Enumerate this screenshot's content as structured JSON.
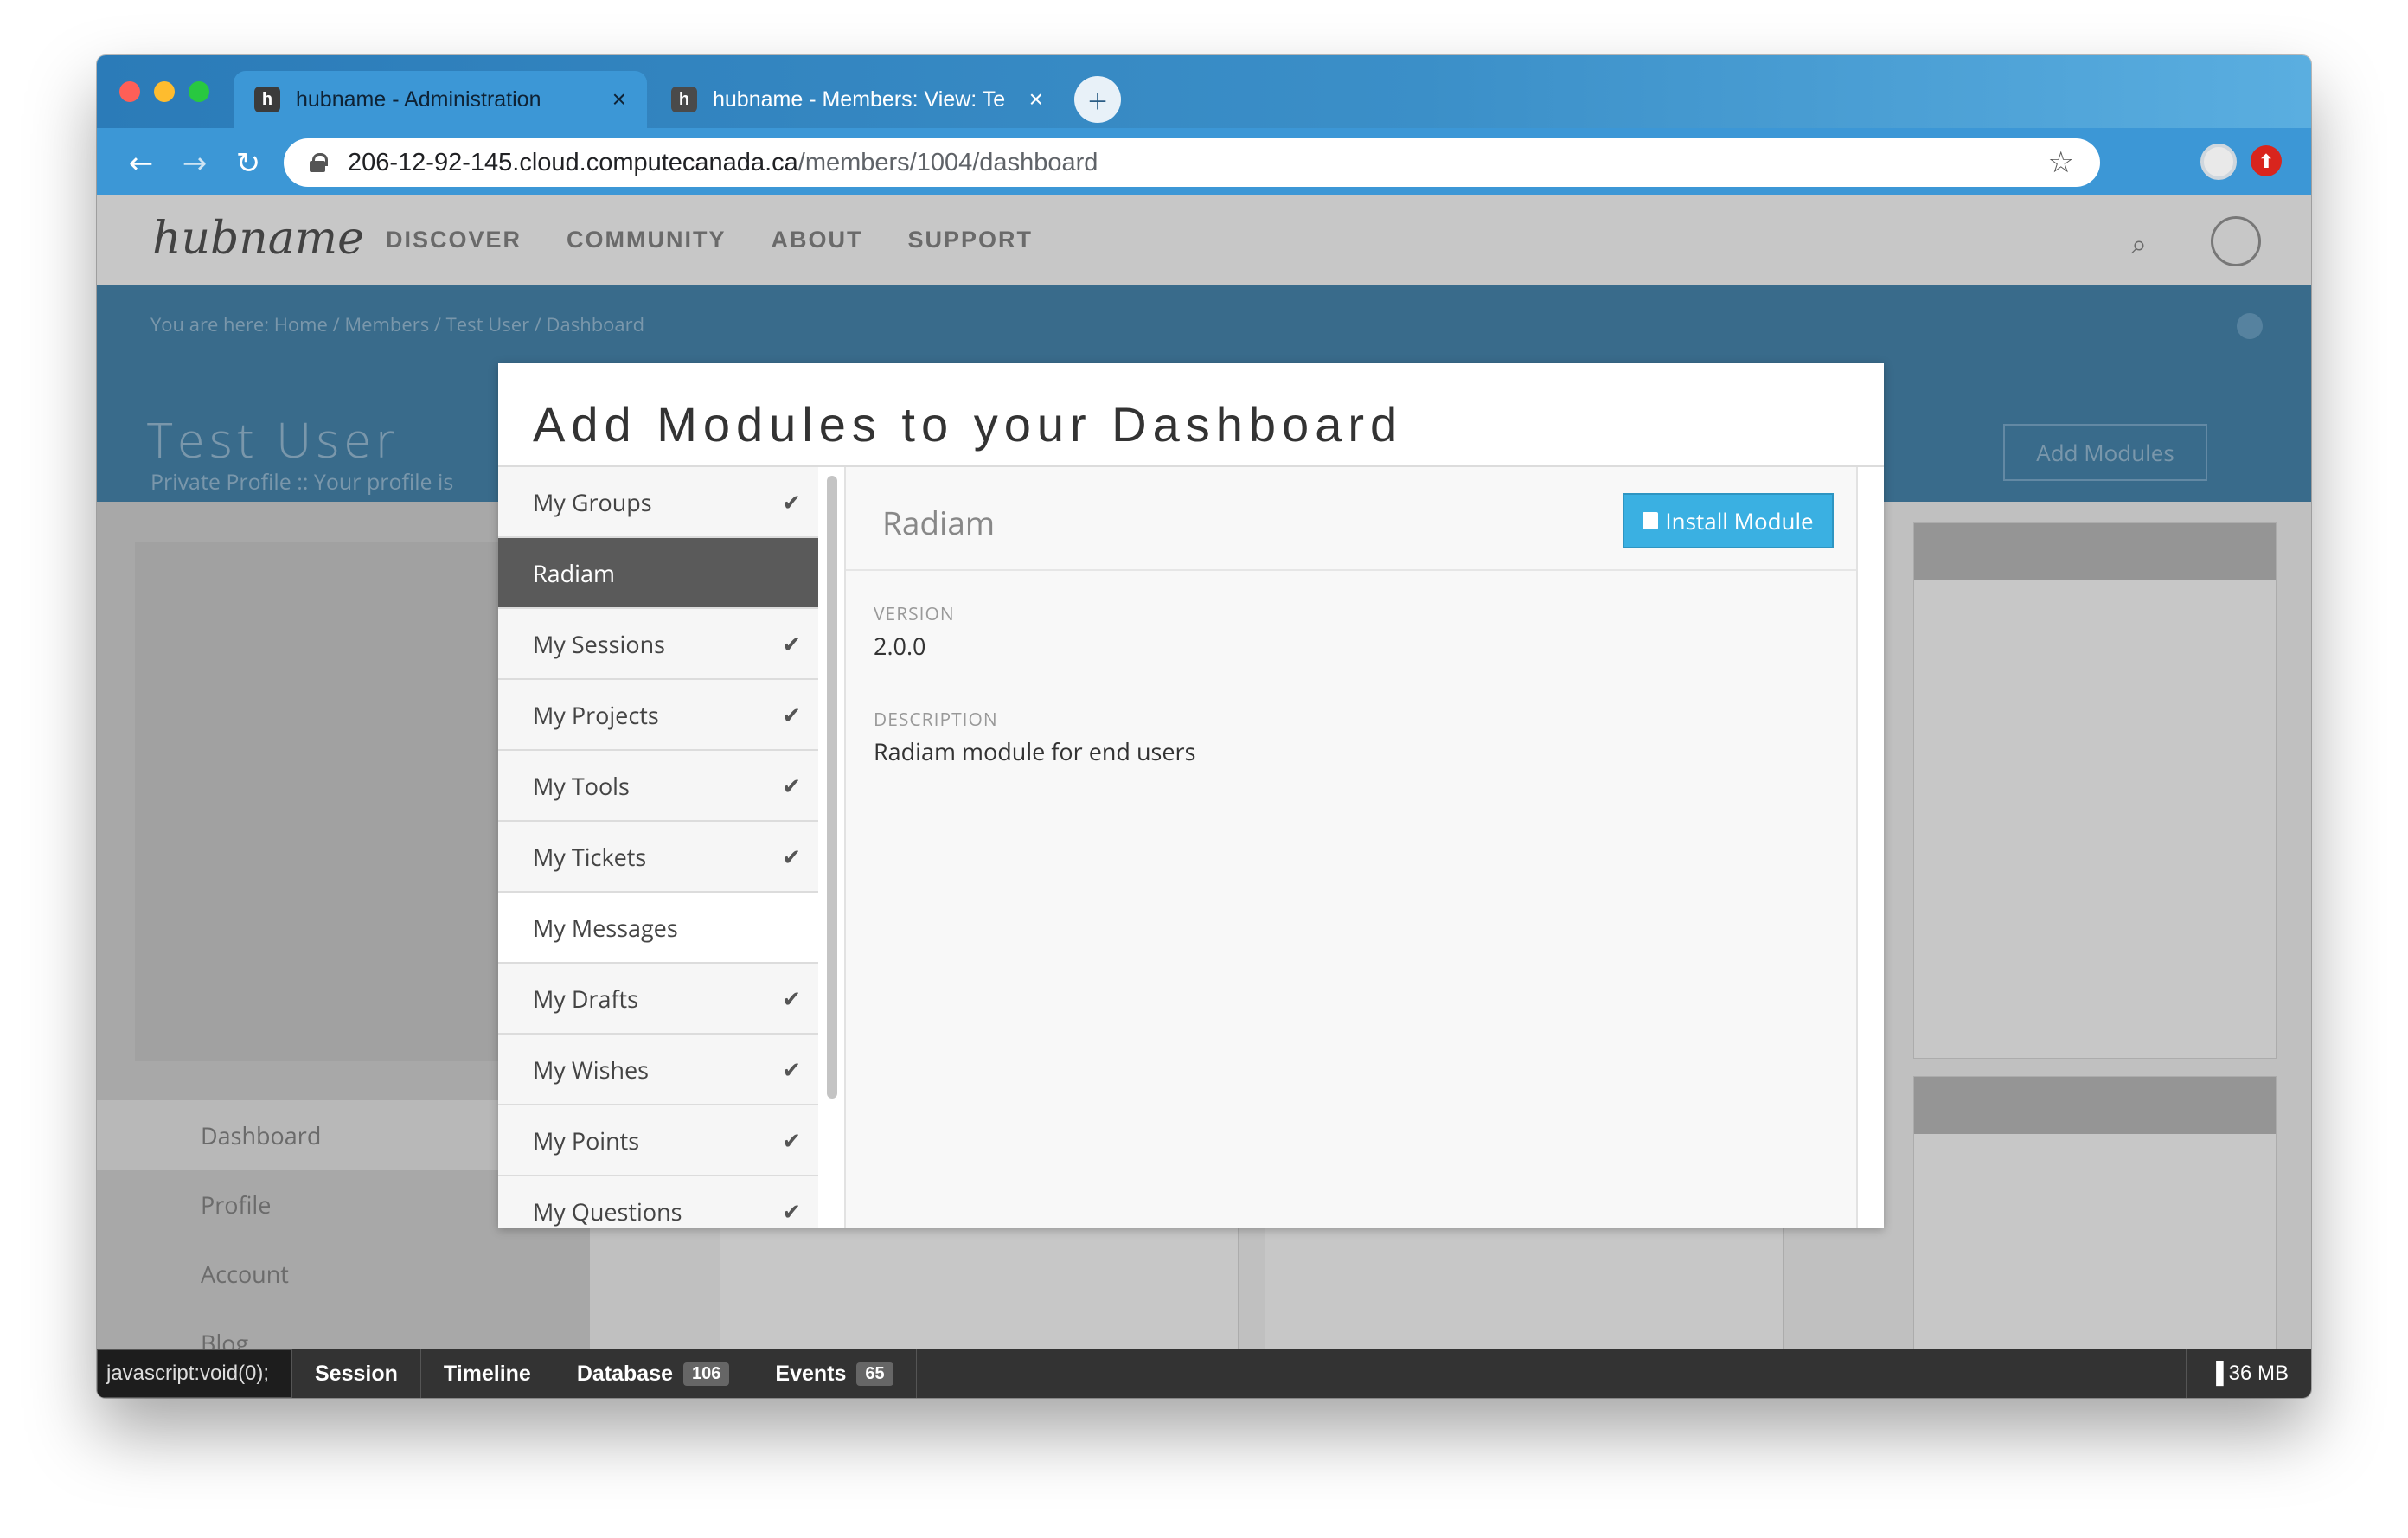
{
  "browser": {
    "tabs": [
      {
        "title": "hubname - Administration",
        "favicon": "h",
        "active": true
      },
      {
        "title": "hubname - Members: View: Te",
        "favicon": "h",
        "active": false
      }
    ],
    "new_tab_label": "+",
    "url_host": "206-12-92-145.cloud.computecanada.ca",
    "url_path": "/members/1004/dashboard"
  },
  "site": {
    "logo": "hubname",
    "nav": [
      "DISCOVER",
      "COMMUNITY",
      "ABOUT",
      "SUPPORT"
    ],
    "breadcrumb": "You are here: Home / Members / Test User / Dashboard",
    "profile_name": "Test User",
    "profile_sub": "Private Profile :: Your profile is",
    "add_modules_label": "Add Modules",
    "sidebar": [
      {
        "label": "Dashboard"
      },
      {
        "label": "Profile"
      },
      {
        "label": "Account"
      },
      {
        "label": "Blog"
      }
    ]
  },
  "modal": {
    "close_glyph": "✕",
    "title": "Add Modules to your Dashboard",
    "modules": [
      {
        "label": "My Groups",
        "installed": true,
        "state": "default"
      },
      {
        "label": "Radiam",
        "installed": false,
        "state": "selected"
      },
      {
        "label": "My Sessions",
        "installed": true,
        "state": "default"
      },
      {
        "label": "My Projects",
        "installed": true,
        "state": "default"
      },
      {
        "label": "My Tools",
        "installed": true,
        "state": "default"
      },
      {
        "label": "My Tickets",
        "installed": true,
        "state": "default"
      },
      {
        "label": "My Messages",
        "installed": false,
        "state": "plain"
      },
      {
        "label": "My Drafts",
        "installed": true,
        "state": "default"
      },
      {
        "label": "My Wishes",
        "installed": true,
        "state": "default"
      },
      {
        "label": "My Points",
        "installed": true,
        "state": "default"
      },
      {
        "label": "My Questions",
        "installed": true,
        "state": "default"
      }
    ],
    "detail": {
      "name": "Radiam",
      "install_label": "Install Module",
      "version_label": "VERSION",
      "version_value": "2.0.0",
      "description_label": "DESCRIPTION",
      "description_value": "Radiam module for end users"
    }
  },
  "debugbar": {
    "status_tip": "javascript:void(0);",
    "tabs": [
      {
        "label": "Session",
        "badge": ""
      },
      {
        "label": "Timeline",
        "badge": ""
      },
      {
        "label": "Database",
        "badge": "106"
      },
      {
        "label": "Events",
        "badge": "65"
      }
    ],
    "memory": "36 MB"
  },
  "colors": {
    "chrome_blue": "#3c97d6",
    "install_button": "#3ab0e2",
    "selected_item": "#5a5a5a"
  }
}
